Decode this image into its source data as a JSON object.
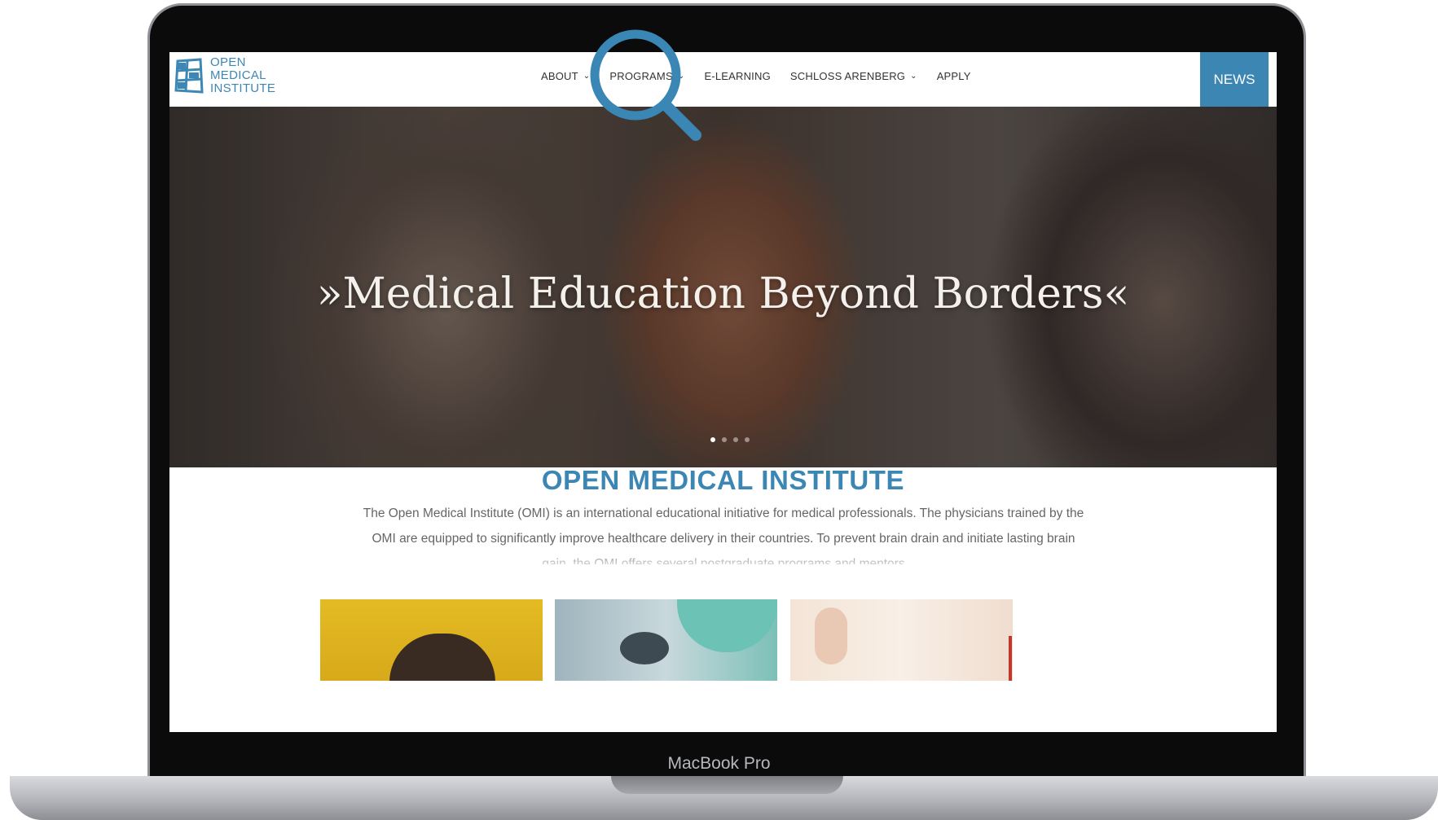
{
  "device": {
    "label": "MacBook Pro"
  },
  "site": {
    "logo": {
      "lines": [
        "OPEN",
        "MEDICAL",
        "INSTITUTE"
      ]
    },
    "nav": [
      {
        "label": "ABOUT",
        "has_dropdown": true
      },
      {
        "label": "PROGRAMS",
        "has_dropdown": true
      },
      {
        "label": "E-LEARNING",
        "has_dropdown": false
      },
      {
        "label": "SCHLOSS ARENBERG",
        "has_dropdown": true
      },
      {
        "label": "APPLY",
        "has_dropdown": false
      }
    ],
    "news_button": "NEWS",
    "hero": {
      "title": "»Medical Education Beyond Borders«",
      "slides_total": 4,
      "active_slide": 1
    },
    "intro": {
      "heading": "OPEN MEDICAL INSTITUTE",
      "text": "The Open Medical Institute (OMI) is an international educational initiative for medical professionals. The physicians trained by the OMI are equipped to significantly improve healthcare delivery in their countries. To prevent brain drain and initiate lasting brain gain, the OMI offers several postgraduate programs and mentors"
    }
  },
  "colors": {
    "brand_blue": "#3c86b3",
    "text_gray": "#666666"
  },
  "icons": [
    "magnifier-icon",
    "chevron-down-icon",
    "logo-globe-icon"
  ]
}
